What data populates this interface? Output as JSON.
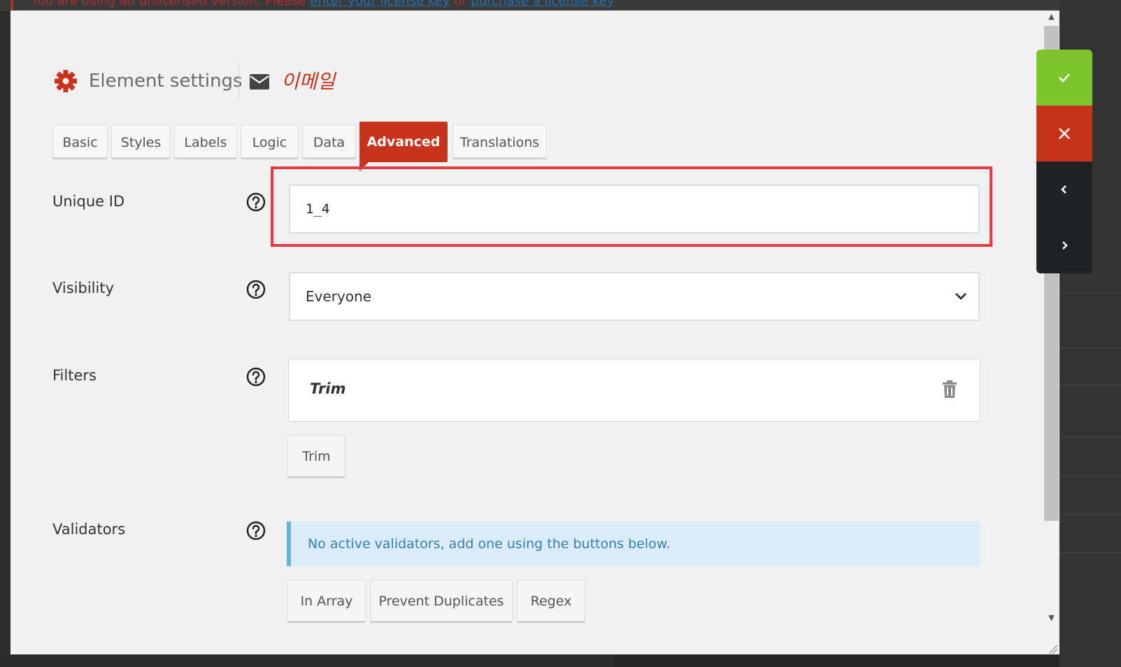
{
  "license_notice": {
    "text_before": "You are using an unlicensed version. Please ",
    "link1": "enter your license key",
    "text_mid": " or ",
    "link2": "purchase a license key"
  },
  "header": {
    "title": "Element settings",
    "element_name": "이메일"
  },
  "tabs": [
    {
      "label": "Basic"
    },
    {
      "label": "Styles"
    },
    {
      "label": "Labels"
    },
    {
      "label": "Logic"
    },
    {
      "label": "Data"
    },
    {
      "label": "Advanced",
      "active": true
    },
    {
      "label": "Translations"
    }
  ],
  "fields": {
    "unique_id": {
      "label": "Unique ID",
      "value": "1_4"
    },
    "visibility": {
      "label": "Visibility",
      "value": "Everyone"
    },
    "filters": {
      "label": "Filters",
      "active_filter": "Trim",
      "add_buttons": [
        "Trim"
      ]
    },
    "validators": {
      "label": "Validators",
      "notice": "No active validators, add one using the buttons below.",
      "add_buttons": [
        "In Array",
        "Prevent Duplicates",
        "Regex"
      ]
    }
  },
  "colors": {
    "accent": "#c9331b",
    "ok": "#7cc52a",
    "highlight": "#e83a45",
    "notice_bg": "#d9ecf7"
  }
}
